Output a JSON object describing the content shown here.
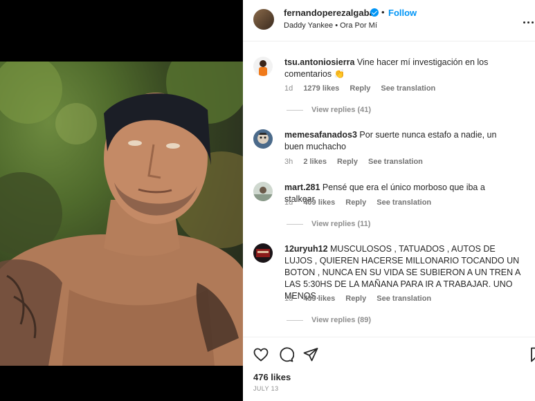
{
  "post": {
    "username": "fernandoperezalgaba",
    "separator": "•",
    "follow_label": "Follow",
    "audio": "Daddy Yankee • Ora Por Mí",
    "likes": "476 likes",
    "date": "JULY 13"
  },
  "comments": [
    {
      "username": "tsu.antoniosierra",
      "text": "Vine hacer mí investigación en los comentarios 👏",
      "time": "1d",
      "likes": "1279 likes",
      "reply_label": "Reply",
      "translate_label": "See translation",
      "view_replies": "View replies (41)"
    },
    {
      "username": "memesafanados3",
      "text": "Por suerte nunca estafo a nadie, un buen muchacho",
      "time": "3h",
      "likes": "2 likes",
      "reply_label": "Reply",
      "translate_label": "See translation"
    },
    {
      "username": "mart.281",
      "text": "Pensé que era el único morboso que iba a stalkear",
      "time": "1d",
      "likes": "409 likes",
      "reply_label": "Reply",
      "translate_label": "See translation",
      "view_replies": "View replies (11)"
    },
    {
      "username": "12uryuh12",
      "text": "MUSCULOSOS , TATUADOS , AUTOS DE LUJOS , QUIEREN HACERSE MILLONARIO TOCANDO UN BOTON , NUNCA EN SU VIDA SE SUBIERON A UN TREN A LAS 5:30HS DE LA MAÑANA PARA IR A TRABAJAR. UNO MENOS.",
      "time": "1d",
      "likes": "439 likes",
      "reply_label": "Reply",
      "translate_label": "See translation",
      "view_replies": "View replies (89)"
    }
  ],
  "icons": {
    "like": "heart-icon",
    "comment": "comment-icon",
    "share": "share-icon",
    "save": "bookmark-icon",
    "more": "more-icon",
    "verified": "verified-badge-icon"
  },
  "colors": {
    "accent": "#0095f6",
    "text": "#262626",
    "muted": "#8e8e8e"
  }
}
